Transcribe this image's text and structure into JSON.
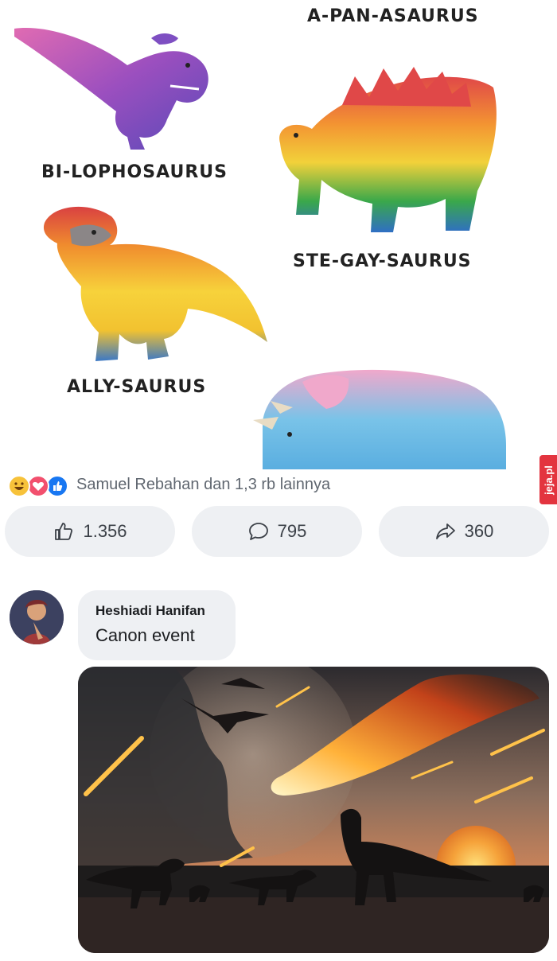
{
  "meme": {
    "labels": {
      "a_pan_asaurus": "A-PAN-ASAURUS",
      "bi_lophosaurus": "BI-LOPHOSAURUS",
      "ste_gay_saurus": "STE-GAY-SAURUS",
      "ally_saurus": "ALLY-SAURUS"
    }
  },
  "post": {
    "reactions": {
      "icons": [
        "haha-icon",
        "love-icon",
        "like-icon"
      ],
      "summary": "Samuel Rebahan dan 1,3 rb lainnya"
    },
    "actions": {
      "like_count": "1.356",
      "comment_count": "795",
      "share_count": "360"
    }
  },
  "comment": {
    "author": "Heshiadi Hanifan",
    "text": "Canon event"
  },
  "watermark": "jeja.pl",
  "colors": {
    "action_bg": "#eef0f3",
    "text_gray": "#606770",
    "watermark_red": "#e3343f"
  }
}
